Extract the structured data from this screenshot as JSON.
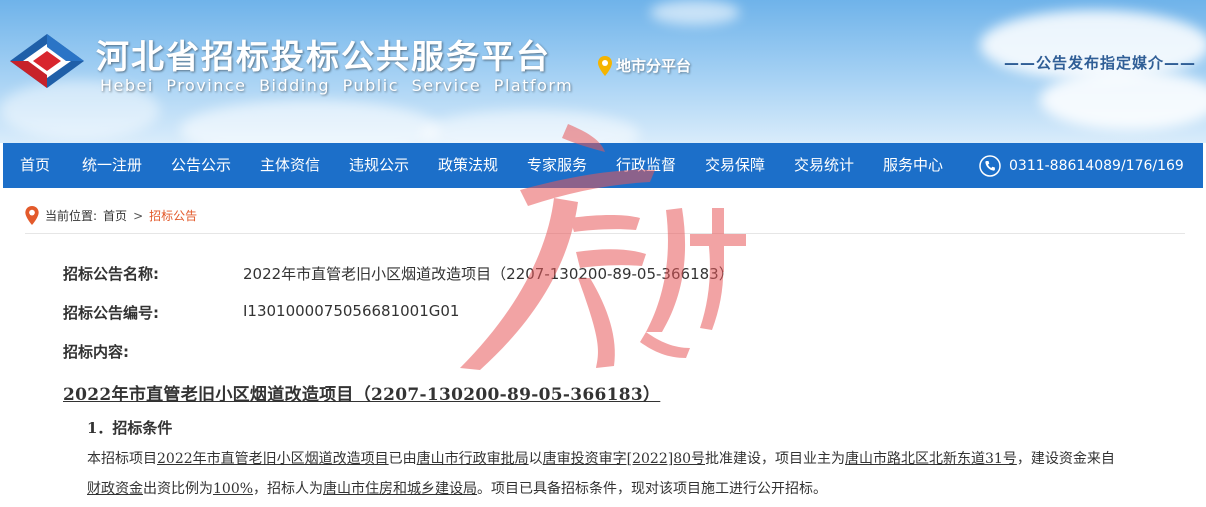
{
  "header": {
    "site_title": "河北省招标投标公共服务平台",
    "site_subtitle": "Hebei Province Bidding Public Service Platform",
    "city_platform": "地市分平台",
    "slogan": "——公告发布指定媒介——"
  },
  "nav": {
    "items": [
      "首页",
      "统一注册",
      "公告公示",
      "主体资信",
      "违规公示",
      "政策法规",
      "专家服务",
      "行政监督",
      "交易保障",
      "交易统计",
      "服务中心"
    ],
    "phone": "0311-88614089/176/169"
  },
  "breadcrumb": {
    "prefix": "当前位置:",
    "home": "首页",
    "separator": ">",
    "current": "招标公告"
  },
  "notice": {
    "name_label": "招标公告名称:",
    "name_value": "2022年市直管老旧小区烟道改造项目（2207-130200-89-05-366183）",
    "number_label": "招标公告编号:",
    "number_value": "I1301000075056681001G01",
    "content_label": "招标内容:",
    "doc_title": "2022年市直管老旧小区烟道改造项目（2207-130200-89-05-366183）",
    "section1_heading": "1．招标条件",
    "para1": {
      "t1": "本招标项目",
      "u1": "2022年市直管老旧小区烟道改造项目",
      "t2": "已由",
      "u2": "唐山市行政审批局",
      "t3": "以",
      "u3": "唐审投资审字[2022]80号",
      "t4": "批准建设，项目业主为",
      "u4": "唐山市路北区北新东道31号",
      "t5": "，建设资金来自",
      "u5": "财政资金",
      "t6": "出资比例为",
      "u6": "100%",
      "t7": "，招标人为",
      "u7": "唐山市住房和城乡建设局",
      "t8": "。项目已具备招标条件，现对该项目施工进行公开招标。"
    }
  },
  "colors": {
    "nav_bg": "#1c6fc9",
    "breadcrumb_current": "#e35a2b",
    "watermark": "#e8585a"
  }
}
